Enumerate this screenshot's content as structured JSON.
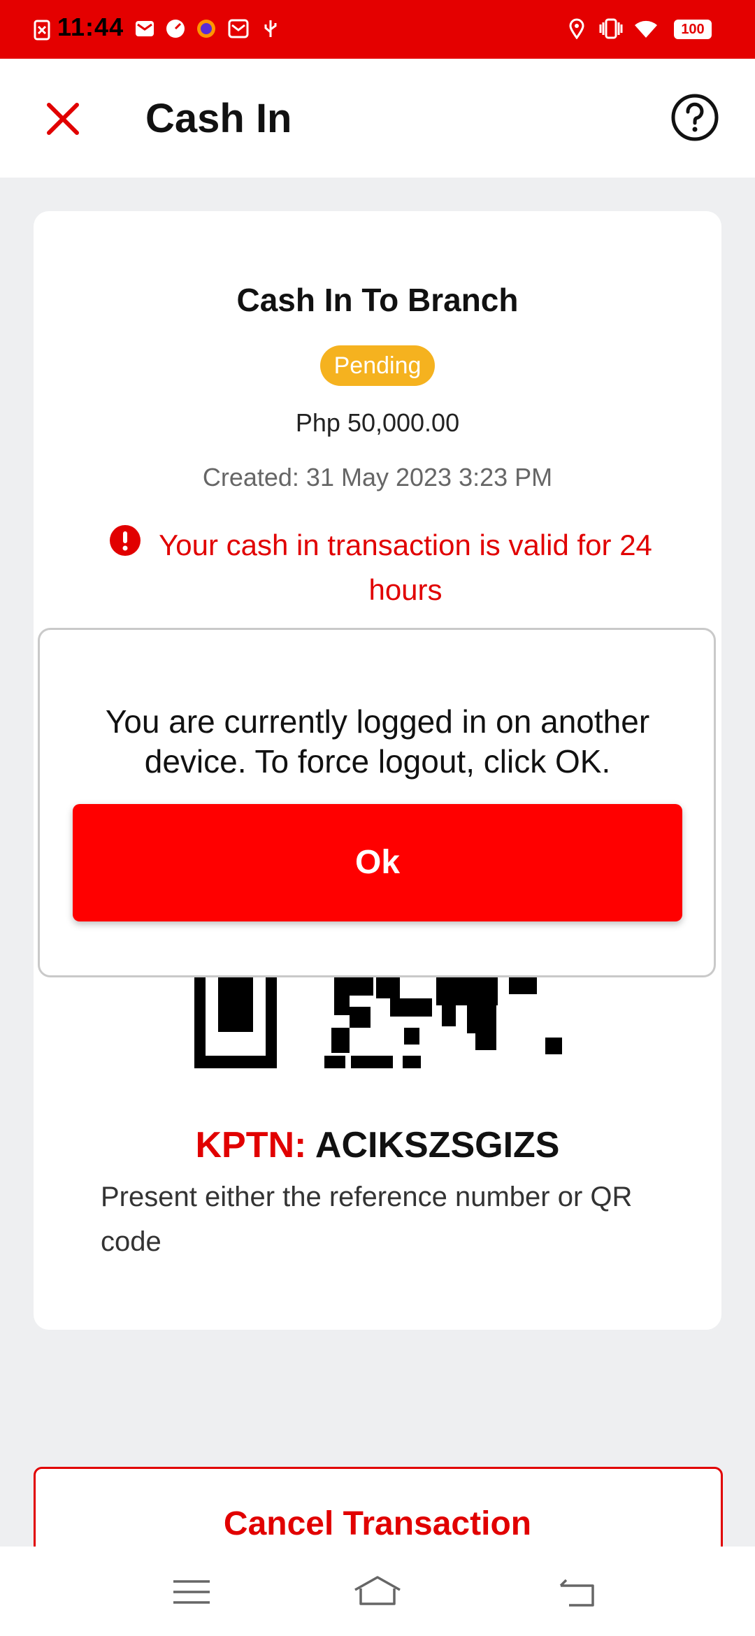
{
  "status_bar": {
    "time": "11:44",
    "battery": "100"
  },
  "header": {
    "title": "Cash In",
    "close_icon": "close-icon",
    "help_icon": "help-icon"
  },
  "card": {
    "title": "Cash In To Branch",
    "status": "Pending",
    "amount": "Php 50,000.00",
    "created": "Created: 31 May 2023 3:23 PM",
    "warning": "Your cash in transaction is valid for 24 hours",
    "kptn_label": "KPTN:",
    "kptn_value": "ACIKSZSGIZS",
    "instructions": "Present either the reference number or QR code"
  },
  "cancel_button": {
    "label": "Cancel Transaction"
  },
  "dialog": {
    "message": "You are currently logged in on another device. To force logout, click OK.",
    "ok_label": "Ok"
  },
  "colors": {
    "brand": "#e40000",
    "accent": "#ff0000",
    "pending": "#f5b21f"
  }
}
